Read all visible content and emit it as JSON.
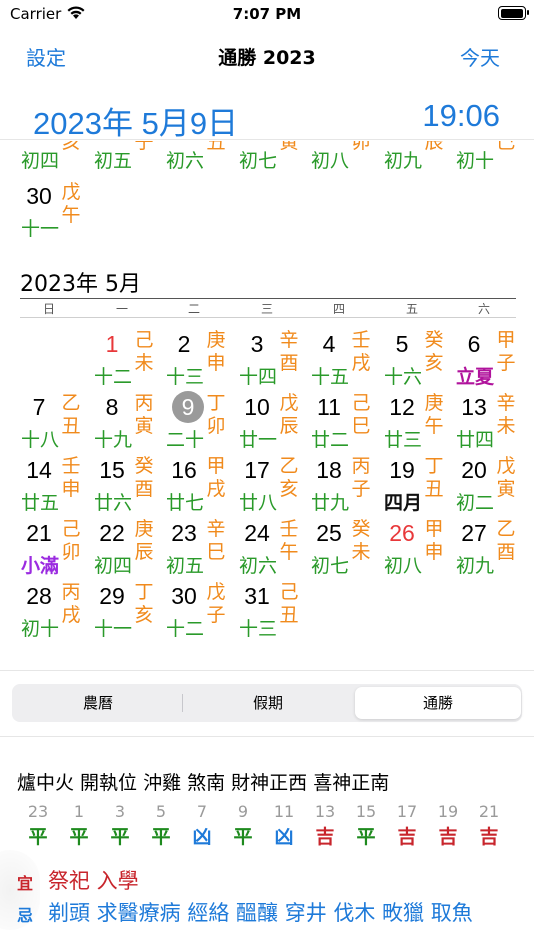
{
  "status_bar": {
    "carrier": "Carrier",
    "time": "7:07 PM",
    "battery_level": 1.0
  },
  "nav": {
    "left_button": "設定",
    "title": "通勝 2023",
    "right_button": "今天"
  },
  "date_header": {
    "date": "2023年 5月9日",
    "time": "19:06"
  },
  "prev_month_rows": [
    [
      {
        "lunar": "初四",
        "gz": "亥"
      },
      {
        "lunar": "初五",
        "gz": "子"
      },
      {
        "lunar": "初六",
        "gz": "丑"
      },
      {
        "lunar": "初七",
        "gz": "寅"
      },
      {
        "lunar": "初八",
        "gz": "卯"
      },
      {
        "lunar": "初九",
        "gz": "辰"
      },
      {
        "lunar": "初十",
        "gz": "巳"
      }
    ],
    [
      {
        "num": "30",
        "lunar": "十一",
        "gz": "戊午"
      }
    ]
  ],
  "month": {
    "title": "2023年 5月",
    "weekdays": [
      "日",
      "一",
      "二",
      "三",
      "四",
      "五",
      "六"
    ],
    "weeks": [
      [
        null,
        {
          "num": "1",
          "lunar": "十二",
          "gz": "己未",
          "red": true
        },
        {
          "num": "2",
          "lunar": "十三",
          "gz": "庚申"
        },
        {
          "num": "3",
          "lunar": "十四",
          "gz": "辛酉"
        },
        {
          "num": "4",
          "lunar": "十五",
          "gz": "壬戌"
        },
        {
          "num": "5",
          "lunar": "十六",
          "gz": "癸亥"
        },
        {
          "num": "6",
          "lunar": "立夏",
          "gz": "甲子",
          "style": "term-red"
        }
      ],
      [
        {
          "num": "7",
          "lunar": "十八",
          "gz": "乙丑"
        },
        {
          "num": "8",
          "lunar": "十九",
          "gz": "丙寅"
        },
        {
          "num": "9",
          "lunar": "二十",
          "gz": "丁卯",
          "today": true
        },
        {
          "num": "10",
          "lunar": "廿一",
          "gz": "戊辰"
        },
        {
          "num": "11",
          "lunar": "廿二",
          "gz": "己巳"
        },
        {
          "num": "12",
          "lunar": "廿三",
          "gz": "庚午"
        },
        {
          "num": "13",
          "lunar": "廿四",
          "gz": "辛未"
        }
      ],
      [
        {
          "num": "14",
          "lunar": "廿五",
          "gz": "壬申"
        },
        {
          "num": "15",
          "lunar": "廿六",
          "gz": "癸酉"
        },
        {
          "num": "16",
          "lunar": "廿七",
          "gz": "甲戌"
        },
        {
          "num": "17",
          "lunar": "廿八",
          "gz": "乙亥"
        },
        {
          "num": "18",
          "lunar": "廿九",
          "gz": "丙子"
        },
        {
          "num": "19",
          "lunar": "四月",
          "gz": "丁丑",
          "style": "month"
        },
        {
          "num": "20",
          "lunar": "初二",
          "gz": "戊寅"
        }
      ],
      [
        {
          "num": "21",
          "lunar": "小滿",
          "gz": "己卯",
          "style": "term-purple"
        },
        {
          "num": "22",
          "lunar": "初四",
          "gz": "庚辰"
        },
        {
          "num": "23",
          "lunar": "初五",
          "gz": "辛巳"
        },
        {
          "num": "24",
          "lunar": "初六",
          "gz": "壬午"
        },
        {
          "num": "25",
          "lunar": "初七",
          "gz": "癸未"
        },
        {
          "num": "26",
          "lunar": "初八",
          "gz": "甲申",
          "red": true
        },
        {
          "num": "27",
          "lunar": "初九",
          "gz": "乙酉"
        }
      ],
      [
        {
          "num": "28",
          "lunar": "初十",
          "gz": "丙戌"
        },
        {
          "num": "29",
          "lunar": "十一",
          "gz": "丁亥"
        },
        {
          "num": "30",
          "lunar": "十二",
          "gz": "戊子"
        },
        {
          "num": "31",
          "lunar": "十三",
          "gz": "己丑"
        },
        null,
        null,
        null
      ]
    ]
  },
  "segments": {
    "items": [
      "農曆",
      "假期",
      "通勝"
    ],
    "selected_index": 2
  },
  "info": {
    "line": "爐中火 開執位  沖雞 煞南  財神正西 喜神正南",
    "hours": [
      {
        "h": "23",
        "luck": "平",
        "color": "green"
      },
      {
        "h": "1",
        "luck": "平",
        "color": "green"
      },
      {
        "h": "3",
        "luck": "平",
        "color": "green"
      },
      {
        "h": "5",
        "luck": "平",
        "color": "green"
      },
      {
        "h": "7",
        "luck": "凶",
        "color": "blue"
      },
      {
        "h": "9",
        "luck": "平",
        "color": "green"
      },
      {
        "h": "11",
        "luck": "凶",
        "color": "blue"
      },
      {
        "h": "13",
        "luck": "吉",
        "color": "red"
      },
      {
        "h": "15",
        "luck": "平",
        "color": "green"
      },
      {
        "h": "17",
        "luck": "吉",
        "color": "red"
      },
      {
        "h": "19",
        "luck": "吉",
        "color": "red"
      },
      {
        "h": "21",
        "luck": "吉",
        "color": "red"
      }
    ],
    "yi_label": "宜",
    "yi": "祭祀 入學",
    "ji_label": "忌",
    "ji": "剃頭 求醫療病 經絡 醞釀 穿井 伐木 畋獵 取魚"
  },
  "colors": {
    "accent": "#1e7ad9",
    "lunar_green": "#2a9a2a",
    "ganzhi_orange": "#f08a1c",
    "holiday_red": "#e8383a",
    "today_gray": "#9a9a9a"
  }
}
